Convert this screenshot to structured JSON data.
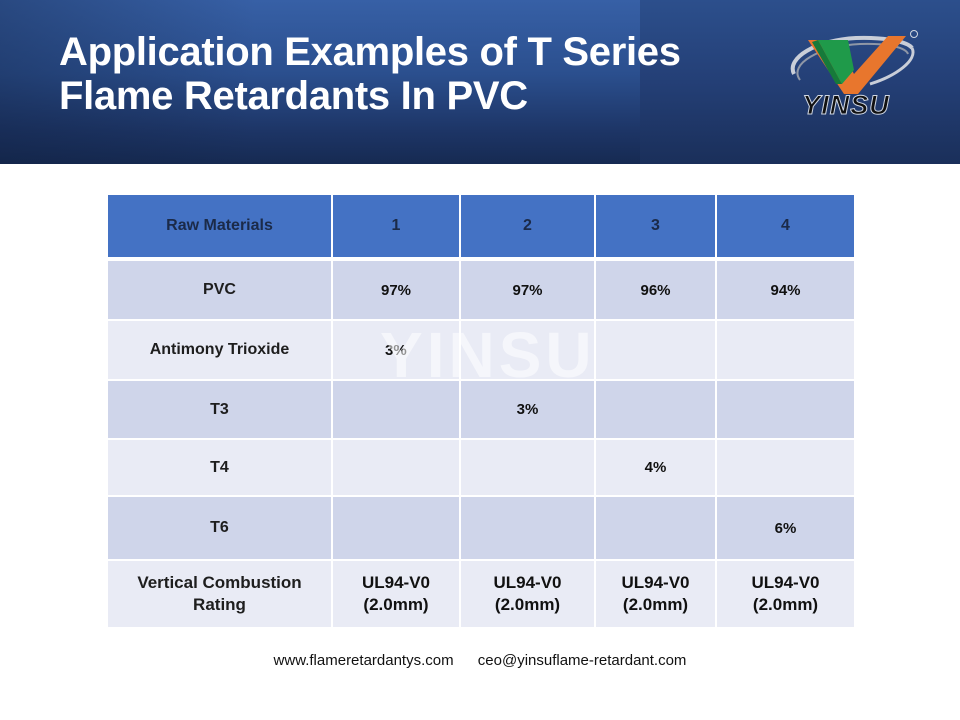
{
  "header": {
    "title_line1": "Application Examples of T Series",
    "title_line2": "Flame Retardants In PVC",
    "logo_text": "YINSU",
    "logo_icon": "yinsu-v-logo-icon",
    "colors": {
      "banner_blue": "#2b4f8e",
      "logo_green": "#1f9a4a",
      "logo_orange": "#e8762d"
    }
  },
  "table": {
    "columns": [
      "Raw Materials",
      "1",
      "2",
      "3",
      "4"
    ],
    "rows": [
      {
        "label": "PVC",
        "values": [
          "97%",
          "97%",
          "96%",
          "94%"
        ]
      },
      {
        "label": "Antimony Trioxide",
        "values": [
          "3%",
          "",
          "",
          ""
        ]
      },
      {
        "label": "T3",
        "values": [
          "",
          "3%",
          "",
          ""
        ]
      },
      {
        "label": "T4",
        "values": [
          "",
          "",
          "4%",
          ""
        ]
      },
      {
        "label": "T6",
        "values": [
          "",
          "",
          "",
          "6%"
        ]
      },
      {
        "label_line1": "Vertical Combustion",
        "label_line2": "Rating",
        "values_line1": [
          "UL94-V0",
          "UL94-V0",
          "UL94-V0",
          "UL94-V0"
        ],
        "values_line2": [
          "(2.0mm)",
          "(2.0mm)",
          "(2.0mm)",
          "(2.0mm)"
        ]
      }
    ],
    "watermark": "YINSU",
    "colors": {
      "header_bg": "#4472c4",
      "row_dark": "#cfd5ea",
      "row_light": "#e9ebf5"
    }
  },
  "footer": {
    "website": "www.flameretardantys.com",
    "email": "ceo@yinsuflame-retardant.com"
  }
}
